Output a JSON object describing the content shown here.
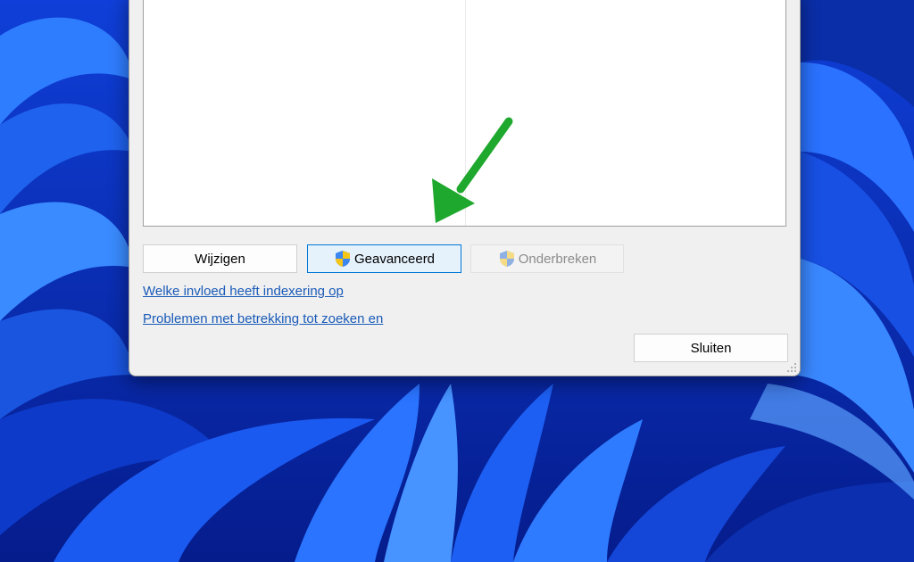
{
  "dialog": {
    "buttons": {
      "wijzigen": "Wijzigen",
      "geavanceerd": "Geavanceerd",
      "onderbreken": "Onderbreken",
      "sluiten": "Sluiten"
    },
    "links": [
      "Welke invloed heeft indexering op",
      "Problemen met betrekking tot zoeken en"
    ]
  },
  "annotation": {
    "arrow_color": "#1fa82e"
  },
  "colors": {
    "wallpaper": "#0a3fd0",
    "dialog_bg": "#f0f0f0",
    "link": "#1a5bb8",
    "primary_border": "#0078d7"
  },
  "icons": {
    "shield": "uac-shield-icon",
    "grip": "resize-grip-icon",
    "arrow": "annotation-arrow"
  }
}
